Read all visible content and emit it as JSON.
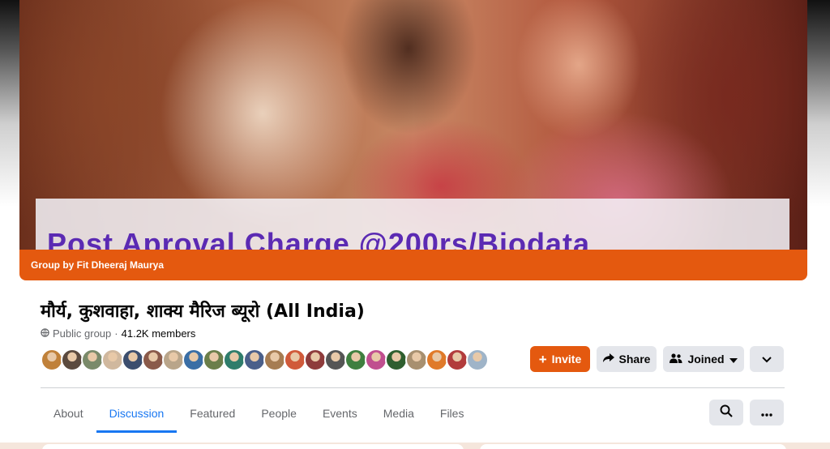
{
  "cover": {
    "banner_text": "Post Aproval Charge @200rs/Biodata",
    "group_by": "Group by Fit Dheeraj Maurya"
  },
  "group": {
    "title": "मौर्य, कुशवाहा, शाक्य मैरिज ब्यूरो (All India)",
    "privacy": "Public group",
    "separator": "·",
    "members": "41.2K members"
  },
  "avatars": [
    "#c0813a",
    "#5b4a3e",
    "#7a8a6a",
    "#d0b89e",
    "#3c4e6e",
    "#8a5a4a",
    "#b9a58a",
    "#3a6ea5",
    "#6b7e4a",
    "#2f7d6b",
    "#4a5f8a",
    "#a67c52",
    "#d05a3a",
    "#8e3b3b",
    "#555",
    "#3f7f3f",
    "#c04f8f",
    "#2f5f2f",
    "#a89070",
    "#e07a2a",
    "#b23c3c",
    "#9fb4c8"
  ],
  "actions": {
    "invite": "Invite",
    "share": "Share",
    "joined": "Joined"
  },
  "tabs": [
    "About",
    "Discussion",
    "Featured",
    "People",
    "Events",
    "Media",
    "Files"
  ],
  "active_tab": "Discussion",
  "colors": {
    "accent": "#e4590f",
    "tab_active": "#1877f2"
  }
}
